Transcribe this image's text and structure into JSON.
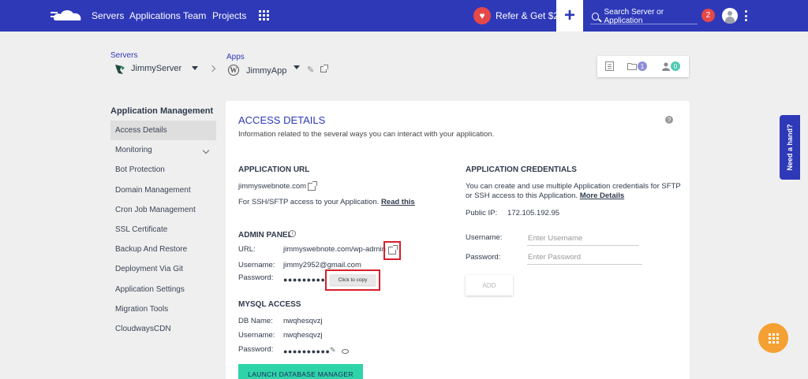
{
  "nav": {
    "links": [
      "Servers",
      "Applications",
      "Team",
      "Projects"
    ],
    "refer_label": "Refer & Get $20",
    "search_placeholder": "Search Server or Application",
    "notification_count": "2",
    "brand_color": "#2e39b8"
  },
  "breadcrumb": {
    "servers_label": "Servers",
    "server_name": "JimmyServer",
    "apps_label": "Apps",
    "app_name": "JimmyApp"
  },
  "toolbar": {
    "files_count": "1",
    "users_count": "0"
  },
  "sidebar": {
    "title": "Application Management",
    "items": [
      {
        "label": "Access Details",
        "active": true
      },
      {
        "label": "Monitoring"
      },
      {
        "label": "Bot Protection"
      },
      {
        "label": "Domain Management"
      },
      {
        "label": "Cron Job Management"
      },
      {
        "label": "SSL Certificate"
      },
      {
        "label": "Backup And Restore"
      },
      {
        "label": "Deployment Via Git"
      },
      {
        "label": "Application Settings"
      },
      {
        "label": "Migration Tools"
      },
      {
        "label": "CloudwaysCDN"
      }
    ]
  },
  "card": {
    "title": "ACCESS DETAILS",
    "description": "Information related to the several ways you can interact with your application.",
    "app_url": {
      "heading": "APPLICATION URL",
      "url": "jimmyswebnote.com",
      "ssh_text": "For SSH/SFTP access to your Application.",
      "read_this": "Read this"
    },
    "admin_panel": {
      "heading": "ADMIN PANEL",
      "url_label": "URL:",
      "url_value": "jimmyswebnote.com/wp-admin",
      "username_label": "Username:",
      "username_value": "jimmy2952@gmail.com",
      "password_label": "Password:",
      "password_mask": "●●●●●●●●●",
      "copy_tooltip": "Click to copy"
    },
    "mysql": {
      "heading": "MYSQL ACCESS",
      "db_label": "DB Name:",
      "db_value": "nwqhesqvzj",
      "username_label": "Username:",
      "username_value": "nwqhesqvzj",
      "password_label": "Password:",
      "password_mask": "●●●●●●●●●●",
      "launch_label": "LAUNCH DATABASE MANAGER"
    },
    "credentials": {
      "heading": "APPLICATION CREDENTIALS",
      "desc_line1": "You can create and use multiple Application credentials for SFTP",
      "desc_line2": "or SSH access to this Application.",
      "more_details": "More Details",
      "public_ip_label": "Public IP:",
      "public_ip_value": "172.105.192.95",
      "username_label": "Username:",
      "username_placeholder": "Enter Username",
      "password_label": "Password:",
      "password_placeholder": "Enter Password",
      "add_label": "ADD"
    }
  },
  "help": {
    "need_hand": "Need a hand?"
  }
}
